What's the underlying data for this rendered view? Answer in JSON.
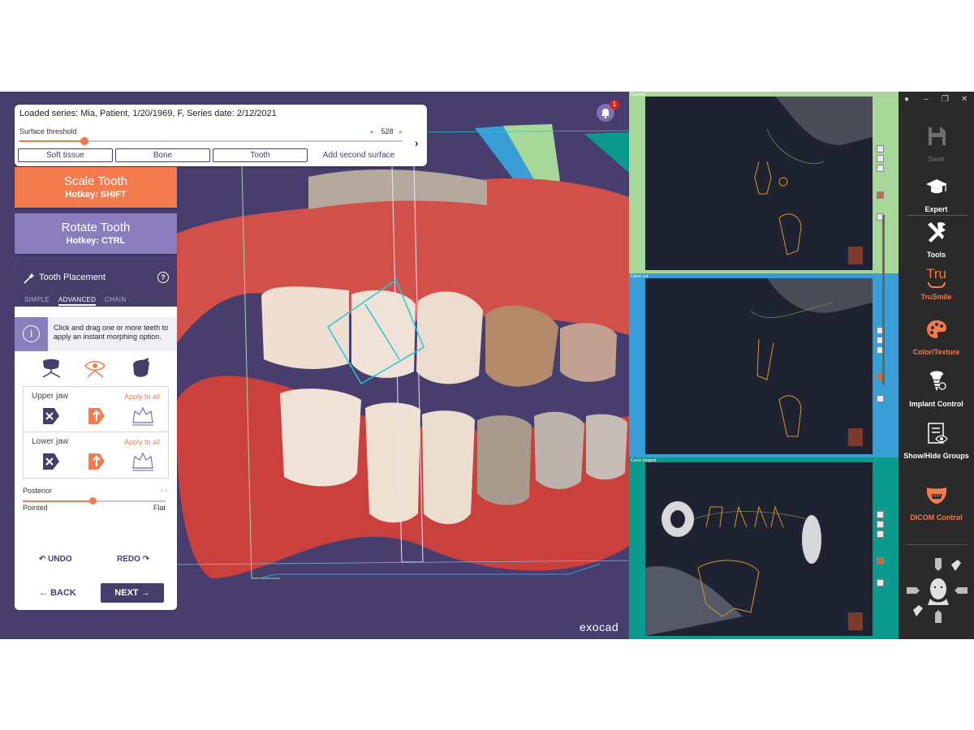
{
  "series": {
    "title": "Loaded series:  Mia, Patient, 1/20/1969, F, Series date: 2/12/2021",
    "threshold_label": "Surface threshold",
    "threshold_value": "528",
    "threshold_fraction": 0.17,
    "buttons": [
      "Soft tissue",
      "Bone",
      "Tooth"
    ],
    "add_surface": "Add second surface",
    "chevron": "›"
  },
  "tools": {
    "scale": {
      "label": "Scale Tooth",
      "hotkey": "Hotkey: SHIFT"
    },
    "rotate": {
      "label": "Rotate Tooth",
      "hotkey": "Hotkey: CTRL"
    }
  },
  "placement": {
    "title": "Tooth Placement",
    "help": "?",
    "tabs": [
      "SIMPLE",
      "ADVANCED",
      "CHAIN"
    ],
    "active_tab": "ADVANCED",
    "info_icon": "i",
    "info_text": "Click and drag one or more teeth to apply an instant morphing option.",
    "upper_jaw": "Upper jaw",
    "lower_jaw": "Lower jaw",
    "apply_all": "Apply to all",
    "posterior_label": "Posterior",
    "posterior_arrows": "‹  ›",
    "posterior_fraction": 0.49,
    "pointed_label": "Pointed",
    "flat_label": "Flat",
    "undo": "UNDO",
    "redo": "REDO",
    "back": "BACK",
    "next": "NEXT"
  },
  "notifications": {
    "count": "1"
  },
  "brand": "exocad",
  "ct_panels": [
    {
      "label": "Coronal",
      "color": "#a7d89a"
    },
    {
      "label": "Curve cut",
      "color": "#3a9ed6"
    },
    {
      "label": "Curve tangent",
      "color": "#0b9b8e"
    }
  ],
  "sidebar": {
    "items": [
      {
        "label": "Save",
        "icon": "save-icon",
        "state": "disabled"
      },
      {
        "label": "Expert",
        "icon": "graduation-cap-icon",
        "state": "normal"
      },
      {
        "label": "Tools",
        "icon": "tools-icon",
        "state": "normal"
      },
      {
        "label": "TruSmile",
        "icon": "trusmile-icon",
        "state": "active"
      },
      {
        "label": "Color/Texture",
        "icon": "palette-icon",
        "state": "active"
      },
      {
        "label": "Implant Control",
        "icon": "implant-icon",
        "state": "normal"
      },
      {
        "label": "Show/Hide Groups",
        "icon": "show-hide-icon",
        "state": "normal"
      },
      {
        "label": "DICOM Control",
        "icon": "dicom-icon",
        "state": "active"
      }
    ],
    "trusmile_text": "Tru"
  },
  "colors": {
    "accent": "#f37b4e",
    "primary": "#463d6b",
    "secondary": "#8a7ebc"
  }
}
